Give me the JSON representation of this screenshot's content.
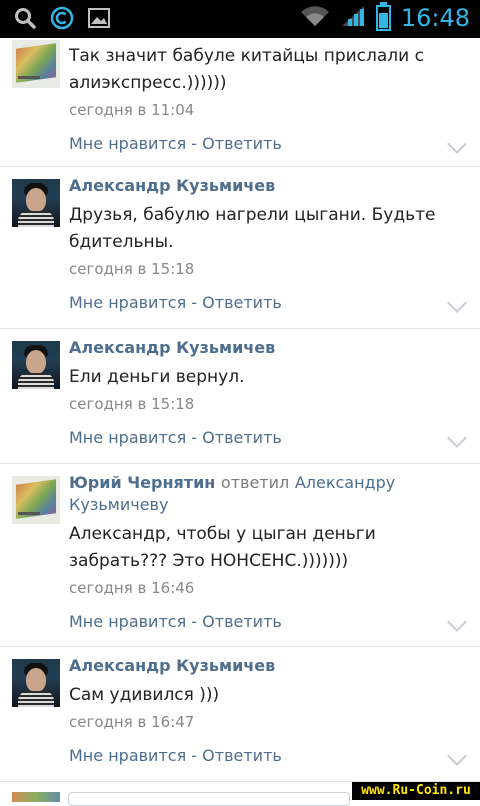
{
  "status_bar": {
    "time": "16:48",
    "icons": [
      "search-icon",
      "vk-app-icon",
      "gallery-icon",
      "wifi-icon",
      "signal-icon",
      "battery-icon"
    ],
    "accent": "#33b5e5"
  },
  "comments": [
    {
      "author": "",
      "text": "Так значит бабуле китайцы прислали с алиэкспресс.))))))",
      "time": "сегодня в 11:04",
      "like": "Мне нравится",
      "sep": "-",
      "reply": "Ответить"
    },
    {
      "author": "Александр Кузьмичев",
      "text": "Друзья, бабулю нагрели цыгани. Будьте бдительны.",
      "time": "сегодня в 15:18",
      "like": "Мне нравится",
      "sep": "-",
      "reply": "Ответить"
    },
    {
      "author": "Александр Кузьмичев",
      "text": "Ели деньги вернул.",
      "time": "сегодня в 15:18",
      "like": "Мне нравится",
      "sep": "-",
      "reply": "Ответить"
    },
    {
      "author": "Юрий Чернятин",
      "replied": "ответил",
      "reply_to_1": "Александру",
      "reply_to_2": "Кузьмичеву",
      "text": "Александр, чтобы у цыган деньги забрать??? Это НОНСЕНС.)))))))",
      "time": "сегодня в 16:46",
      "like": "Мне нравится",
      "sep": "-",
      "reply": "Ответить"
    },
    {
      "author": "Александр Кузьмичев",
      "text": "Сам удивился )))",
      "time": "сегодня в 16:47",
      "like": "Мне нравится",
      "sep": "-",
      "reply": "Ответить"
    }
  ],
  "watermark": "www.Ru-Coin.ru",
  "colors": {
    "link": "#4f6e8e",
    "text": "#222222",
    "muted": "#888888",
    "divider": "#e3e6e9"
  }
}
